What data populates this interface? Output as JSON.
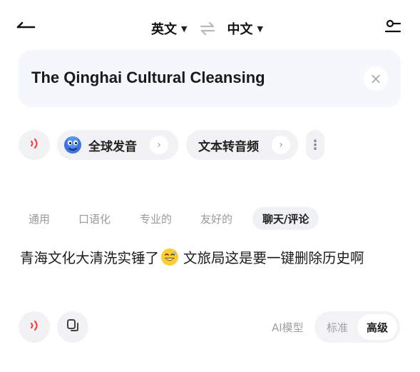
{
  "header": {
    "source_lang": "英文",
    "target_lang": "中文",
    "back_icon": "back-arrow-icon",
    "swap_icon": "swap-icon",
    "settings_icon": "settings-icon"
  },
  "input": {
    "text": "The Qinghai Cultural Cleansing",
    "clear_symbol": "×"
  },
  "pronunciation": {
    "global_label": "全球发音",
    "tts_label": "文本转音频",
    "arrow_symbol": "›",
    "more_symbol": "⋮"
  },
  "tabs": [
    {
      "label": "通用",
      "active": false
    },
    {
      "label": "口语化",
      "active": false
    },
    {
      "label": "专业的",
      "active": false
    },
    {
      "label": "友好的",
      "active": false
    },
    {
      "label": "聊天/评论",
      "active": true
    }
  ],
  "output": {
    "text_before": "青海文化大清洗实锤了",
    "emoji": "grinning-sweat-emoji",
    "text_after": "文旅局这是要一键删除历史啊"
  },
  "footer": {
    "ai_label": "AI模型",
    "option_standard": "标准",
    "option_advanced": "高级",
    "selected": "高级"
  },
  "colors": {
    "accent_red": "#f0463c",
    "input_bg": "#f4f7fb",
    "chip_bg": "#f2f2f4"
  }
}
